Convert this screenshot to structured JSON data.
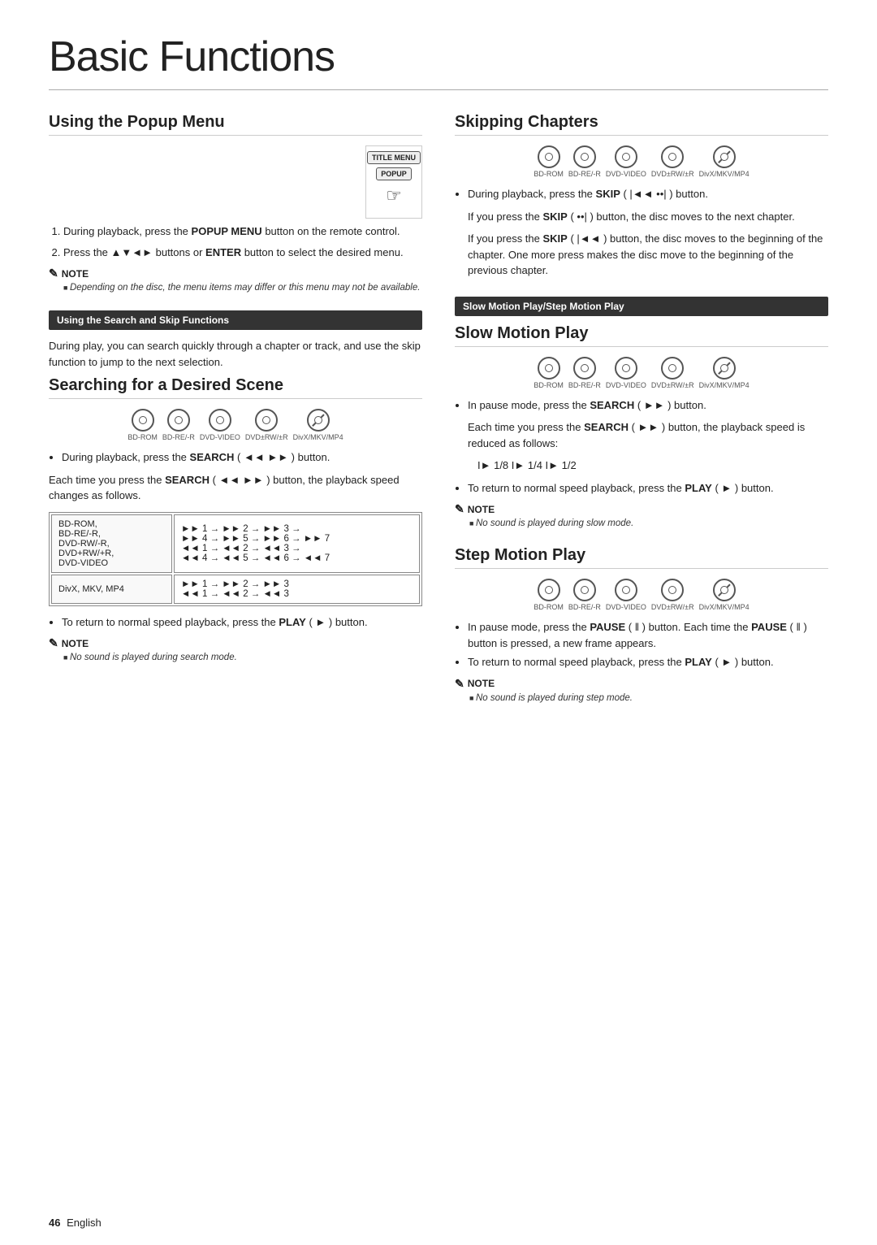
{
  "page": {
    "title": "Basic Functions",
    "footer": "46",
    "footer_lang": "English"
  },
  "left_col": {
    "popup_section": {
      "title": "Using the Popup Menu",
      "steps": [
        {
          "num": "1",
          "text_before": "During playback, press the ",
          "bold": "POPUP MENU",
          "text_after": " button on the remote control."
        },
        {
          "num": "2",
          "text_before": "Press the ▲▼◄► buttons or ",
          "bold": "ENTER",
          "text_after": " button to select the desired menu."
        }
      ],
      "note_title": "NOTE",
      "note_text": "Depending on the disc, the menu items may differ or this menu may not be available."
    },
    "search_skip_banner": "Using the Search and Skip Functions",
    "search_skip_text": "During play, you can search quickly through a chapter or track, and use the skip function to jump to the next selection.",
    "searching_section": {
      "title": "Searching for a Desired Scene",
      "disc_icons": [
        "BD-ROM",
        "BD-RE/-R",
        "DVD-VIDEO",
        "DVD±RW/±R",
        "DivX/MKV/MP4"
      ],
      "bullet1_before": "During playback, press the ",
      "bullet1_bold": "SEARCH",
      "bullet1_after": " (◄◄ ►► ) button.",
      "para1_before": "Each time you press the ",
      "para1_bold": "SEARCH",
      "para1_after": " (◄◄ ►► ) button, the playback speed changes as follows.",
      "table": {
        "rows": [
          {
            "label": "BD-ROM,\nBD-RE/-R,\nDVD-RW/-R,\nDVD+RW/+R,\nDVD-VIDEO",
            "values": "►► 1 → ►► 2 → ►► 3 →\n►► 4 → ►► 5 → ►► 6 → ►► 7\n◄◄ 1 → ◄◄ 2 → ◄◄ 3 →\n◄◄ 4 → ◄◄ 5 → ◄◄ 6 → ◄◄ 7"
          },
          {
            "label": "DivX, MKV, MP4",
            "values": "►► 1 → ►► 2 → ►► 3\n◄◄ 1 → ◄◄ 2 → ◄◄ 3"
          }
        ]
      },
      "bullet2_before": "To return to normal speed playback, press the ",
      "bullet2_bold": "PLAY",
      "bullet2_after": " ( ► ) button.",
      "note_title": "NOTE",
      "note_text": "No sound is played during search mode."
    }
  },
  "right_col": {
    "skipping_section": {
      "title": "Skipping Chapters",
      "disc_icons": [
        "BD-ROM",
        "BD-RE/-R",
        "DVD-VIDEO",
        "DVD±RW/±R",
        "DivX/MKV/MP4"
      ],
      "bullet1_before": "During playback, press the ",
      "bullet1_bold": "SKIP",
      "bullet1_after": " ( |◄◄ ►►| ) button.",
      "para1_before": "If you press the ",
      "para1_bold1": "SKIP",
      "para1_mid1": " ( ►►| ) button, the disc moves to the next chapter.",
      "para2_before": "If you press the ",
      "para2_bold1": "SKIP",
      "para2_mid1": " ( |◄◄ ) button, the disc moves to the beginning of the chapter. One more press makes the disc move to the beginning of the previous chapter."
    },
    "slow_motion_banner": "Slow Motion Play/Step Motion Play",
    "slow_motion_section": {
      "title": "Slow Motion Play",
      "disc_icons": [
        "BD-ROM",
        "BD-RE/-R",
        "DVD-VIDEO",
        "DVD±RW/±R",
        "DivX/MKV/MP4"
      ],
      "bullet1_before": "In pause mode, press the ",
      "bullet1_bold": "SEARCH",
      "bullet1_after": " ( ►► ) button.",
      "para1_before": "Each time you press the ",
      "para1_bold": "SEARCH",
      "para1_after": " ( ►► ) button, the playback speed is reduced as follows:",
      "speeds": "I► 1/8  I► 1/4  I► 1/2",
      "bullet2_before": "To return to normal speed playback, press the ",
      "bullet2_bold": "PLAY",
      "bullet2_after": " ( ► ) button.",
      "note_title": "NOTE",
      "note_text": "No sound is played during slow mode."
    },
    "step_motion_section": {
      "title": "Step Motion Play",
      "disc_icons": [
        "BD-ROM",
        "BD-RE/-R",
        "DVD-VIDEO",
        "DVD±RW/±R",
        "DivX/MKV/MP4"
      ],
      "bullet1_before": "In pause mode, press the ",
      "bullet1_bold": "PAUSE",
      "bullet1_after": " ( ‖ ) button. Each time the ",
      "bullet1_bold2": "PAUSE",
      "bullet1_after2": " ( ‖ ) button is pressed, a new frame appears.",
      "bullet2_before": "To return to normal speed playback, press the ",
      "bullet2_bold": "PLAY",
      "bullet2_after": " ( ► ) button.",
      "note_title": "NOTE",
      "note_text": "No sound is played during step mode."
    }
  }
}
